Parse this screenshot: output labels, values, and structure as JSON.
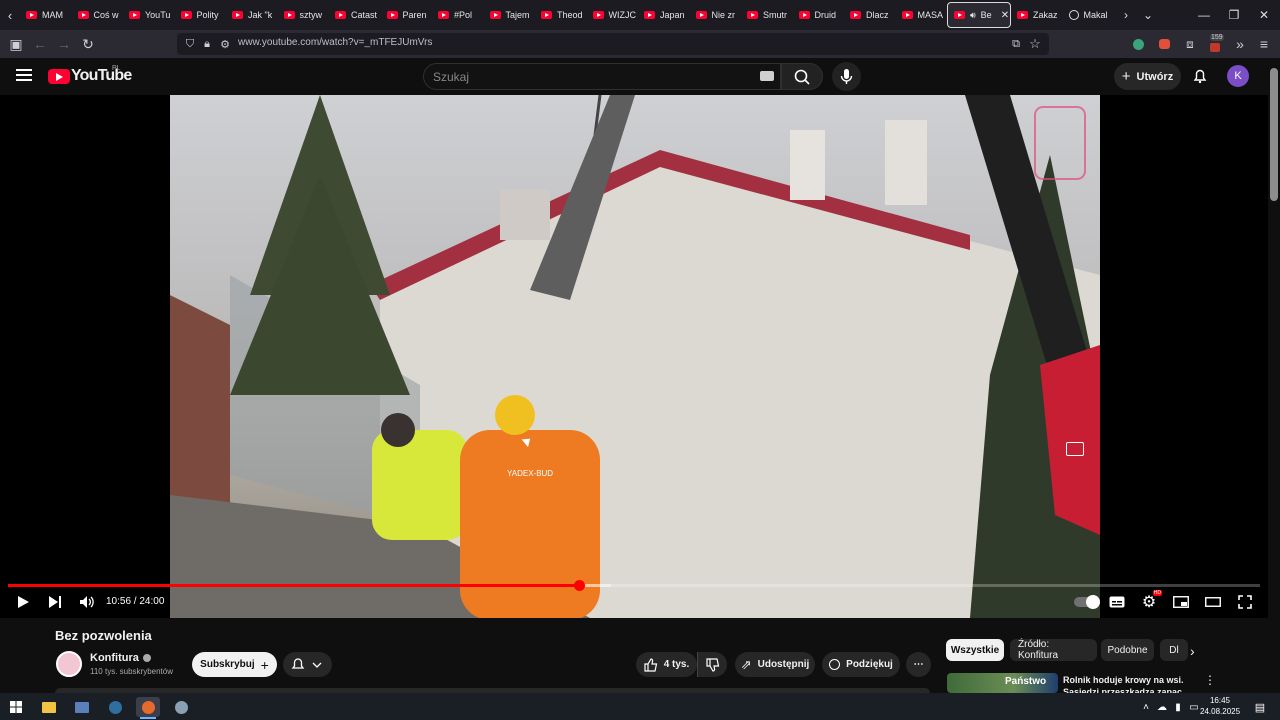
{
  "browser": {
    "tabs": [
      {
        "label": "MAM"
      },
      {
        "label": "Coś w"
      },
      {
        "label": "YouTu"
      },
      {
        "label": "Polity"
      },
      {
        "label": "Jak \"k"
      },
      {
        "label": "sztyw"
      },
      {
        "label": "Catast"
      },
      {
        "label": "Paren"
      },
      {
        "label": "#Pol"
      },
      {
        "label": "Tajem"
      },
      {
        "label": "Theod"
      },
      {
        "label": "WIZJC"
      },
      {
        "label": "Japan"
      },
      {
        "label": "Nie zr"
      },
      {
        "label": "Smutr"
      },
      {
        "label": "Druid"
      },
      {
        "label": "Dlacz"
      },
      {
        "label": "MASA"
      },
      {
        "label": "Be",
        "active": true,
        "audio": true
      },
      {
        "label": "Zakaz"
      },
      {
        "label": "Makal"
      }
    ],
    "url": "www.youtube.com/watch?v=_mTFEJUmVrs",
    "extension_badge": "159"
  },
  "youtube": {
    "logo_text": "YouTube",
    "country_code": "PL",
    "search_placeholder": "Szukaj",
    "create_label": "Utwórz",
    "avatar_letter": "K"
  },
  "player": {
    "current_time": "10:56",
    "duration": "24:00",
    "time_display": "10:56 / 24:00",
    "progress_fraction": 0.456,
    "buffer_fraction": 0.482
  },
  "video": {
    "title": "Bez pozwolenia",
    "channel": "Konfitura",
    "subscribers": "110 tys. subskrybentów",
    "subscribe_label": "Subskrybuj",
    "likes": "4 tys.",
    "share_label": "Udostępnij",
    "thanks_label": "Podziękuj",
    "worker_jacket_text": "YADEX-BUD"
  },
  "chips": [
    {
      "label": "Wszystkie",
      "active": true
    },
    {
      "label": "Źródło: Konfitura"
    },
    {
      "label": "Podobne"
    },
    {
      "label": "Dl"
    }
  ],
  "recommendation": {
    "thumb_text": "Państwo",
    "title": "Rolnik hoduje krowy na wsi. Sąsiedzi przeszkadza zapac"
  },
  "taskbar": {
    "time": "16:45",
    "date": "24.08.2025"
  },
  "colors": {
    "accent_red": "#ff0000",
    "yt_red": "#ff0033",
    "background": "#0f0f0f"
  }
}
